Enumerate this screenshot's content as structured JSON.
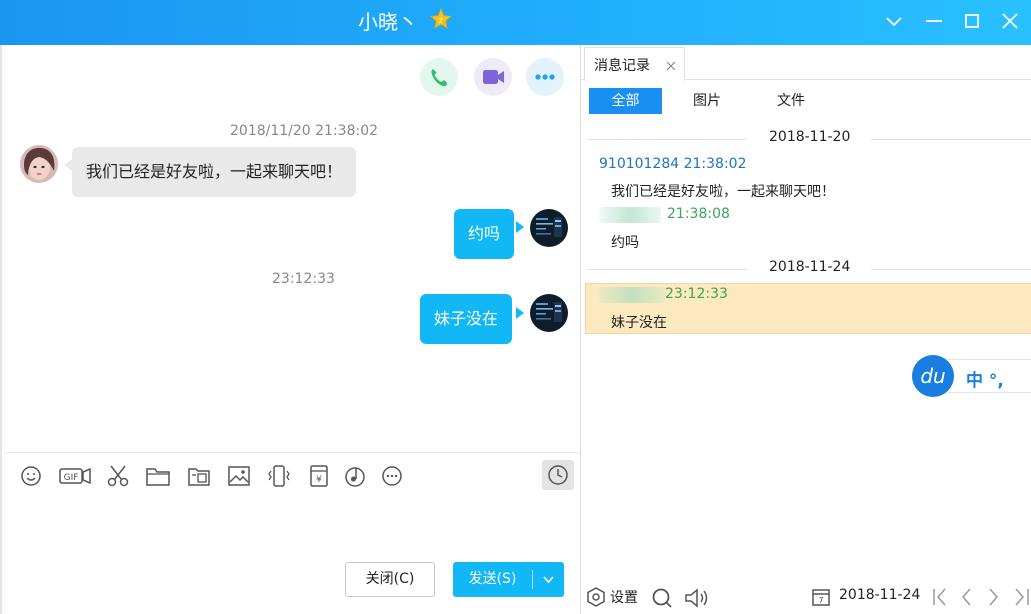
{
  "window": {
    "title": "小晓丶",
    "controls": [
      "chevron-down",
      "minimize",
      "maximize",
      "close"
    ]
  },
  "chat": {
    "call_buttons": [
      "phone-icon",
      "video-icon",
      "more-icon"
    ],
    "messages": [
      {
        "timestamp": "2018/11/20 21:38:02"
      },
      {
        "direction": "in",
        "text": "我们已经是好友啦，一起来聊天吧！"
      },
      {
        "direction": "out",
        "text": "约吗"
      },
      {
        "timestamp": "23:12:33"
      },
      {
        "direction": "out",
        "text": "妹子没在"
      }
    ],
    "toolbar_icons": [
      "emoji-icon",
      "gif-icon",
      "scissors-icon",
      "folder-icon",
      "image-folder-icon",
      "image-icon",
      "shake-icon",
      "red-packet-icon",
      "music-icon",
      "more-circle-icon",
      "history-clock-icon"
    ],
    "close_label": "关闭(C)",
    "send_label": "发送(S)"
  },
  "history": {
    "tab_label": "消息记录",
    "filters": [
      "全部",
      "图片",
      "文件"
    ],
    "active_filter": "全部",
    "groups": [
      {
        "date": "2018-11-20",
        "entries": [
          {
            "sender": "910101284 21:38:02",
            "text": "我们已经是好友啦，一起来聊天吧！",
            "self": false
          },
          {
            "sender": "21:38:08",
            "text": "约吗",
            "self": true
          }
        ]
      },
      {
        "date": "2018-11-24",
        "entries": [
          {
            "sender": "23:12:33",
            "text": "妹子没在",
            "self": true
          }
        ]
      }
    ],
    "ime_text": "中 °,",
    "footer": {
      "settings_label": "设置",
      "date": "2018-11-24"
    },
    "colors": {
      "peer_sender": "#1a74c8",
      "self_sender": "#3aa65a",
      "accent": "#12b7f5",
      "highlight": "#fde9c0"
    }
  }
}
